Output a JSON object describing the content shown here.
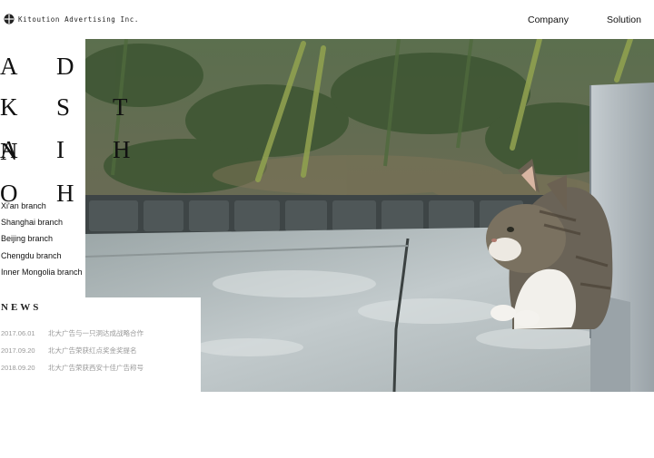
{
  "header": {
    "company_name": "Kitoution Advertising Inc.",
    "nav": [
      {
        "label": "Company"
      },
      {
        "label": "Solution"
      }
    ]
  },
  "brand_letters": [
    "A",
    "D",
    "K",
    "S",
    "T",
    "A",
    "I",
    "H",
    "N",
    "O",
    "H"
  ],
  "branches": [
    {
      "label": "Xi'an branch"
    },
    {
      "label": "Shanghai branch"
    },
    {
      "label": "Beijing branch"
    },
    {
      "label": "Chengdu branch"
    },
    {
      "label": "Inner Mongolia branch"
    }
  ],
  "news": {
    "title": "NEWS",
    "items": [
      {
        "date": "2017.06.01",
        "text": "北大广告与一只洞达成战略合作"
      },
      {
        "date": "2017.09.20",
        "text": "北大广告荣获红点奖金奖提名"
      },
      {
        "date": "2018.09.20",
        "text": "北大广告荣获西安十佳广告称号"
      }
    ]
  },
  "hero": {
    "icon": "cat-photo",
    "colors": {
      "foliage": "#3f5a35",
      "stone": "#a7b0ac",
      "pavement": "#b9c2c4"
    }
  }
}
